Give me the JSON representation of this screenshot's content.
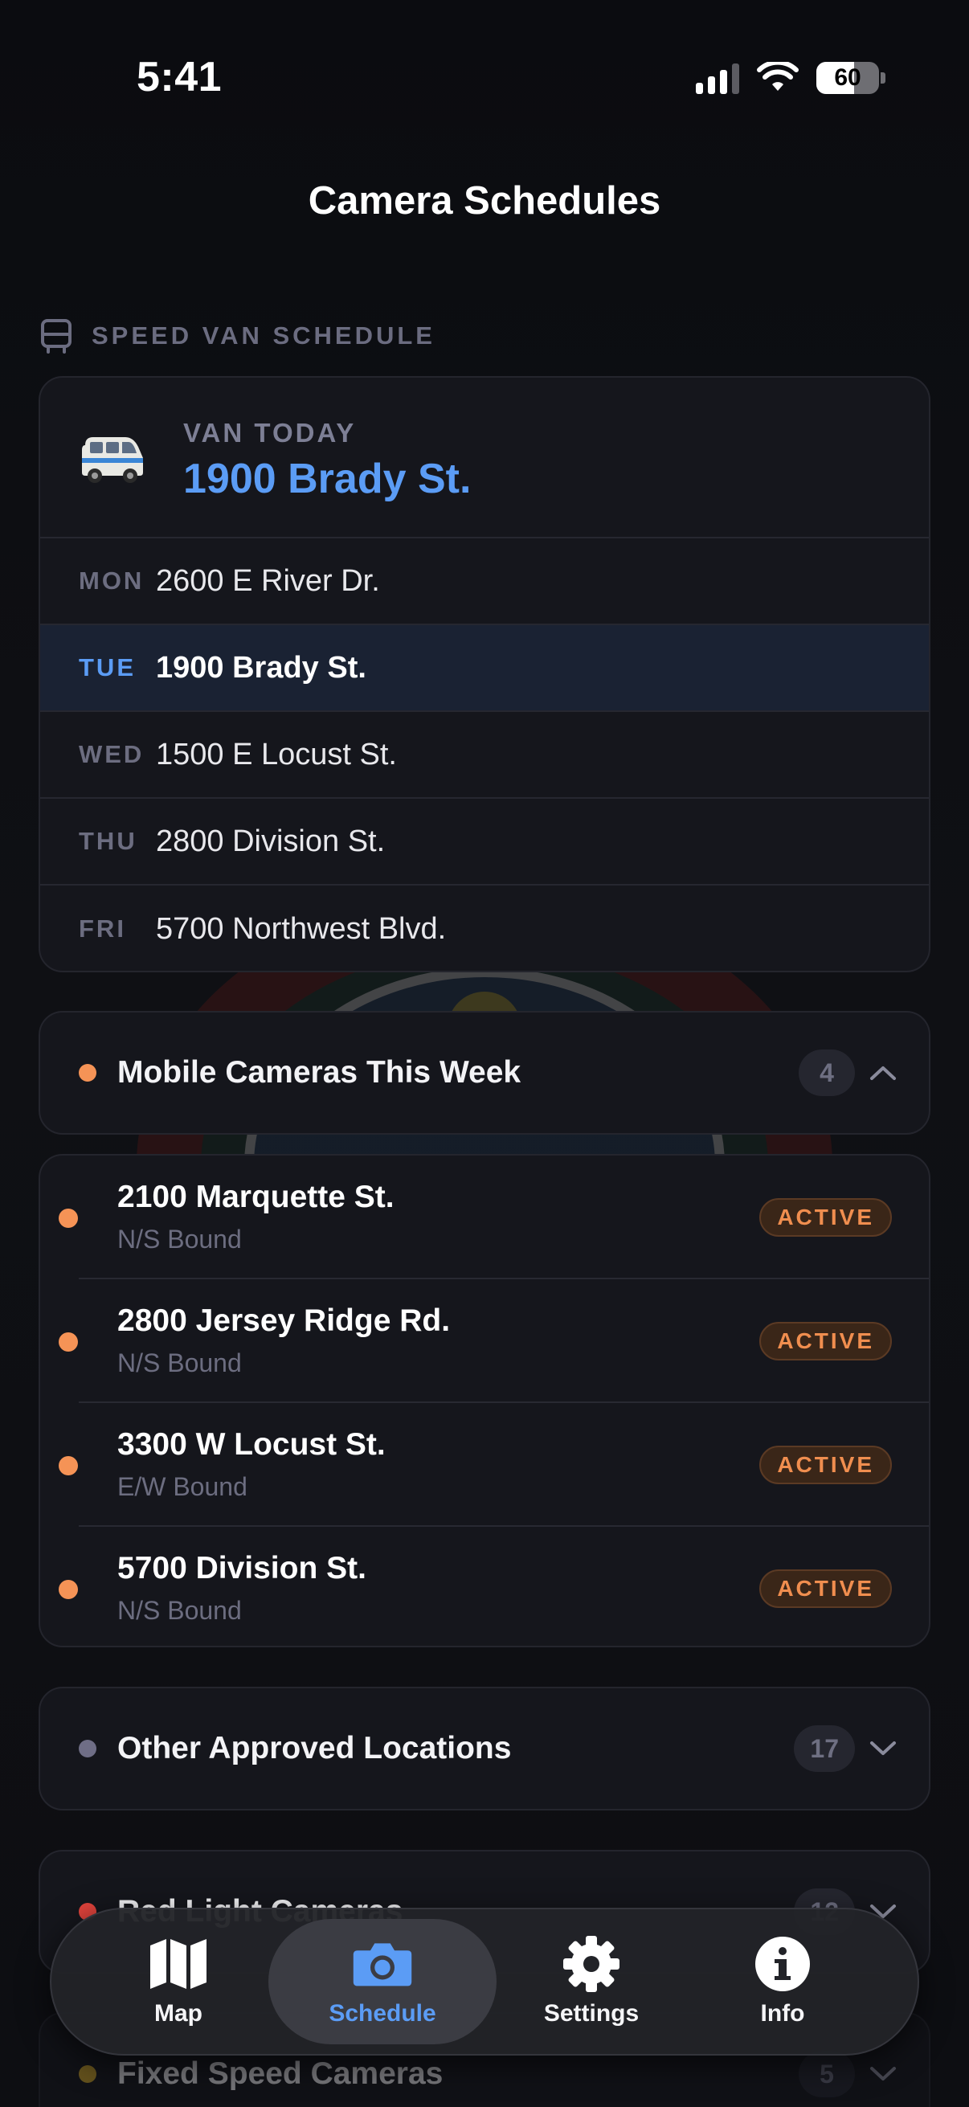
{
  "status_bar": {
    "time": "5:41",
    "battery_percent": "60",
    "battery_level": 0.6
  },
  "nav": {
    "title": "Camera Schedules"
  },
  "van_section": {
    "header": "SPEED VAN SCHEDULE",
    "header_icon": "bus-icon",
    "today_label": "VAN TODAY",
    "today_address": "1900 Brady St.",
    "today_icon": "minibus-icon",
    "days": [
      {
        "day": "MON",
        "address": "2600 E River Dr.",
        "current": false
      },
      {
        "day": "TUE",
        "address": "1900 Brady St.",
        "current": true
      },
      {
        "day": "WED",
        "address": "1500 E Locust St.",
        "current": false
      },
      {
        "day": "THU",
        "address": "2800 Division St.",
        "current": false
      },
      {
        "day": "FRI",
        "address": "5700 Northwest Blvd.",
        "current": false
      }
    ]
  },
  "mobile_cameras": {
    "title": "Mobile Cameras This Week",
    "count": "4",
    "expanded": true,
    "dot_color": "#f59356",
    "items": [
      {
        "address": "2100 Marquette St.",
        "direction": "N/S Bound",
        "status": "ACTIVE"
      },
      {
        "address": "2800 Jersey Ridge Rd.",
        "direction": "N/S Bound",
        "status": "ACTIVE"
      },
      {
        "address": "3300 W Locust St.",
        "direction": "E/W Bound",
        "status": "ACTIVE"
      },
      {
        "address": "5700 Division St.",
        "direction": "N/S Bound",
        "status": "ACTIVE"
      }
    ]
  },
  "other_locations": {
    "title": "Other Approved Locations",
    "count": "17",
    "dot_color": "#6f6e86"
  },
  "red_light": {
    "title": "Red Light Cameras",
    "count": "12",
    "dot_color": "#e0433c"
  },
  "fixed_speed": {
    "title": "Fixed Speed Cameras",
    "count": "5",
    "dot_color": "#c9a12a"
  },
  "tab_bar": {
    "tabs": [
      {
        "label": "Map",
        "icon": "map-icon",
        "active": false
      },
      {
        "label": "Schedule",
        "icon": "camera-icon",
        "active": true
      },
      {
        "label": "Settings",
        "icon": "gear-icon",
        "active": false
      },
      {
        "label": "Info",
        "icon": "info-icon",
        "active": false
      }
    ]
  },
  "colors": {
    "accent": "#5b9cf5",
    "active_badge": "#f08e4f",
    "background": "#0d0e12",
    "card": "#15161c"
  }
}
